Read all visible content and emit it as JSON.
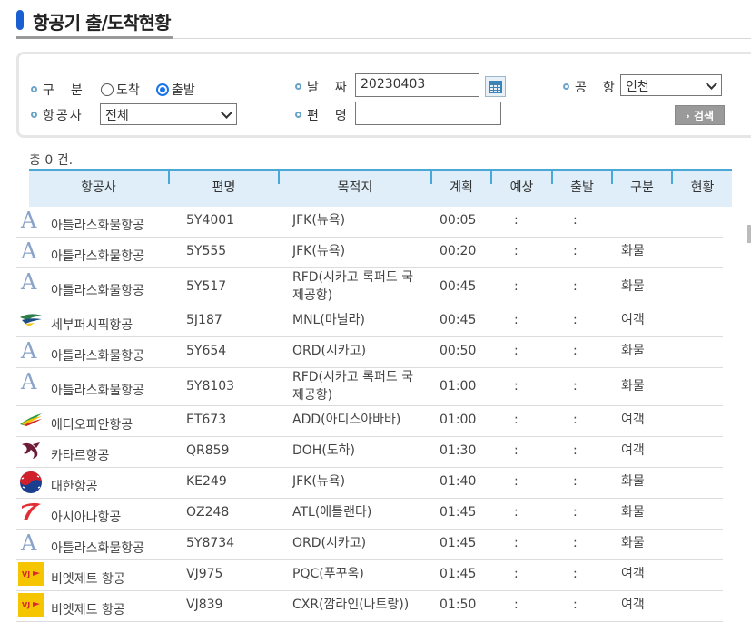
{
  "page": {
    "title": "항공기 출/도착현황"
  },
  "search": {
    "type_label": "구　분",
    "radio_arrival": "도착",
    "radio_departure": "출발",
    "date_label": "날　짜",
    "date_value": "20230403",
    "airport_label": "공　항",
    "airport_value": "인천",
    "airline_label": "항공사",
    "airline_value": "전체",
    "flight_label": "편　명",
    "flight_value": "",
    "search_button": "› 검색",
    "selected_type": "departure"
  },
  "result_count": "총 0 건.",
  "table": {
    "headers": [
      "항공사",
      "편명",
      "목적지",
      "계획",
      "예상",
      "출발",
      "구분",
      "현황"
    ],
    "rows": [
      {
        "logo": "atlas-logo",
        "airline": "아틀라스화물항공",
        "flight": "5Y4001",
        "dest1": "JFK(뉴욕)",
        "dest2": "",
        "plan": "00:05",
        "est": ":",
        "dep": ":",
        "type": "",
        "status": ""
      },
      {
        "logo": "atlas-logo",
        "airline": "아틀라스화물항공",
        "flight": "5Y555",
        "dest1": "JFK(뉴욕)",
        "dest2": "",
        "plan": "00:20",
        "est": ":",
        "dep": ":",
        "type": "화물",
        "status": ""
      },
      {
        "logo": "atlas-logo",
        "airline": "아틀라스화물항공",
        "flight": "5Y517",
        "dest1": "RFD(시카고 록퍼드 국",
        "dest2": "제공항)",
        "plan": "00:45",
        "est": ":",
        "dep": ":",
        "type": "화물",
        "status": ""
      },
      {
        "logo": "cebu-logo",
        "airline": "세부퍼시픽항공",
        "flight": "5J187",
        "dest1": "MNL(마닐라)",
        "dest2": "",
        "plan": "00:45",
        "est": ":",
        "dep": ":",
        "type": "여객",
        "status": ""
      },
      {
        "logo": "atlas-logo",
        "airline": "아틀라스화물항공",
        "flight": "5Y654",
        "dest1": "ORD(시카고)",
        "dest2": "",
        "plan": "00:50",
        "est": ":",
        "dep": ":",
        "type": "화물",
        "status": ""
      },
      {
        "logo": "atlas-logo",
        "airline": "아틀라스화물항공",
        "flight": "5Y8103",
        "dest1": "RFD(시카고 록퍼드 국",
        "dest2": "제공항)",
        "plan": "01:00",
        "est": ":",
        "dep": ":",
        "type": "화물",
        "status": ""
      },
      {
        "logo": "ethiopian-logo",
        "airline": "에티오피안항공",
        "flight": "ET673",
        "dest1": "ADD(아디스아바바)",
        "dest2": "",
        "plan": "01:00",
        "est": ":",
        "dep": ":",
        "type": "여객",
        "status": ""
      },
      {
        "logo": "qatar-logo",
        "airline": "카타르항공",
        "flight": "QR859",
        "dest1": "DOH(도하)",
        "dest2": "",
        "plan": "01:30",
        "est": ":",
        "dep": ":",
        "type": "여객",
        "status": ""
      },
      {
        "logo": "korean-air-logo",
        "airline": "대한항공",
        "flight": "KE249",
        "dest1": "JFK(뉴욕)",
        "dest2": "",
        "plan": "01:40",
        "est": ":",
        "dep": ":",
        "type": "화물",
        "status": ""
      },
      {
        "logo": "asiana-logo",
        "airline": "아시아나항공",
        "flight": "OZ248",
        "dest1": "ATL(애틀랜타)",
        "dest2": "",
        "plan": "01:45",
        "est": ":",
        "dep": ":",
        "type": "화물",
        "status": ""
      },
      {
        "logo": "atlas-logo",
        "airline": "아틀라스화물항공",
        "flight": "5Y8734",
        "dest1": "ORD(시카고)",
        "dest2": "",
        "plan": "01:45",
        "est": ":",
        "dep": ":",
        "type": "화물",
        "status": ""
      },
      {
        "logo": "vietjet-logo",
        "airline": "비엣제트 항공",
        "flight": "VJ975",
        "dest1": "PQC(푸꾸옥)",
        "dest2": "",
        "plan": "01:45",
        "est": ":",
        "dep": ":",
        "type": "여객",
        "status": ""
      },
      {
        "logo": "vietjet-logo",
        "airline": "비엣제트 항공",
        "flight": "VJ839",
        "dest1": "CXR(깜라인(나트랑))",
        "dest2": "",
        "plan": "01:50",
        "est": ":",
        "dep": ":",
        "type": "여객",
        "status": ""
      }
    ]
  },
  "colors": {
    "accent": "#4aa8d8",
    "header_bg": "#dfeef8",
    "title_mark": "#1a5fd1"
  }
}
